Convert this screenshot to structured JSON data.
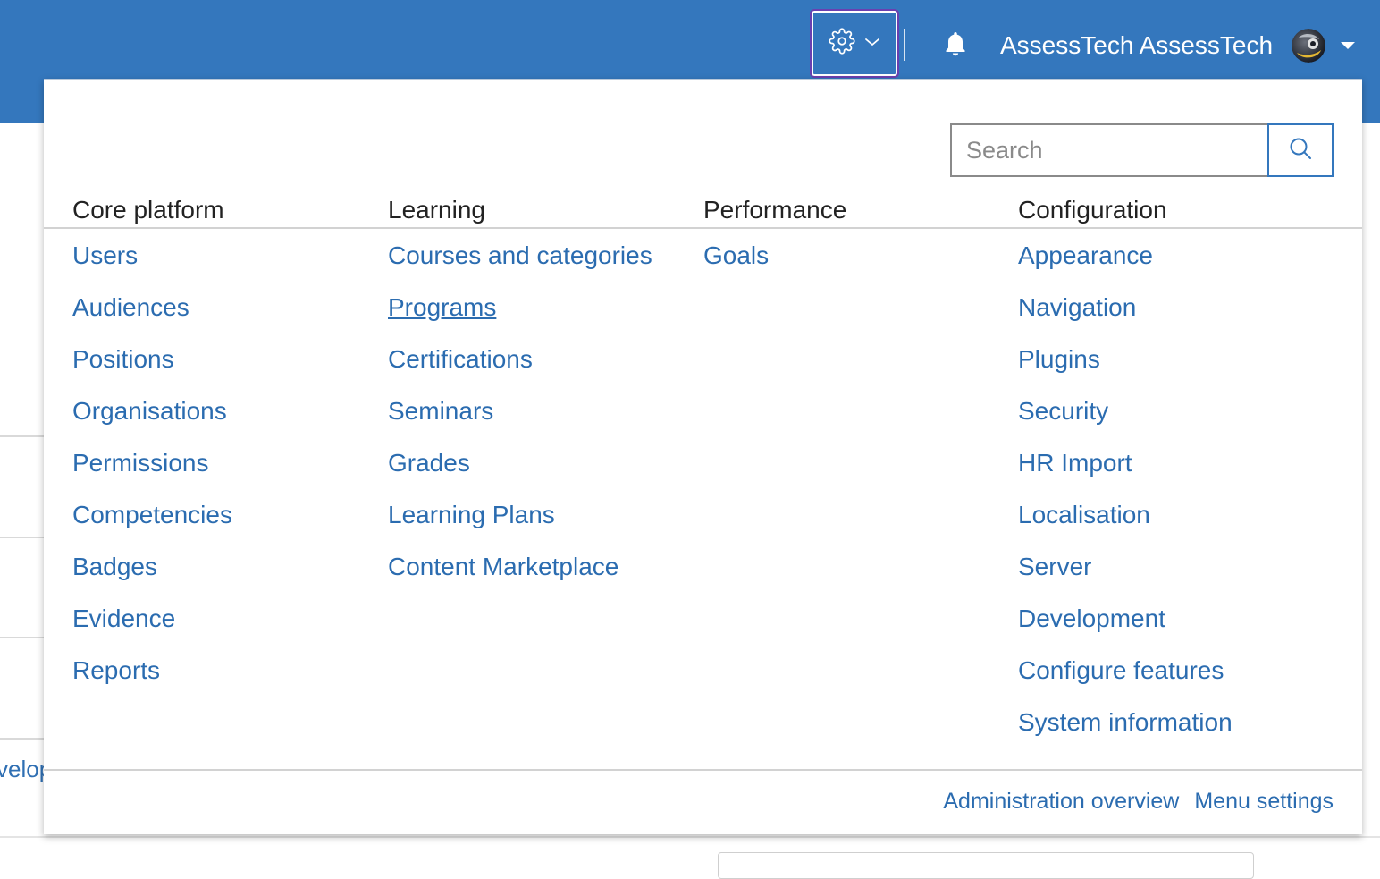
{
  "header": {
    "user_name": "AssessTech AssessTech",
    "nav_color": "#3477bd"
  },
  "background": {
    "partial_text": "velop"
  },
  "admin_menu": {
    "search": {
      "placeholder": "Search",
      "value": ""
    },
    "columns": [
      {
        "heading": "Core platform",
        "items": [
          "Users",
          "Audiences",
          "Positions",
          "Organisations",
          "Permissions",
          "Competencies",
          "Badges",
          "Evidence",
          "Reports"
        ]
      },
      {
        "heading": "Learning",
        "items": [
          "Courses and categories",
          "Programs",
          "Certifications",
          "Seminars",
          "Grades",
          "Learning Plans",
          "Content Marketplace"
        ]
      },
      {
        "heading": "Performance",
        "items": [
          "Goals"
        ]
      },
      {
        "heading": "Configuration",
        "items": [
          "Appearance",
          "Navigation",
          "Plugins",
          "Security",
          "HR Import",
          "Localisation",
          "Server",
          "Development",
          "Configure features",
          "System information"
        ]
      }
    ],
    "hovered_item": "Programs",
    "footer": {
      "overview_label": "Administration overview",
      "settings_label": "Menu settings"
    },
    "link_color": "#2b6cb0"
  },
  "icons": {
    "admin": "gear-icon",
    "admin_caret": "chevron-down-icon",
    "notifications": "bell-icon",
    "user_caret": "caret-down-icon",
    "search": "search-icon"
  }
}
